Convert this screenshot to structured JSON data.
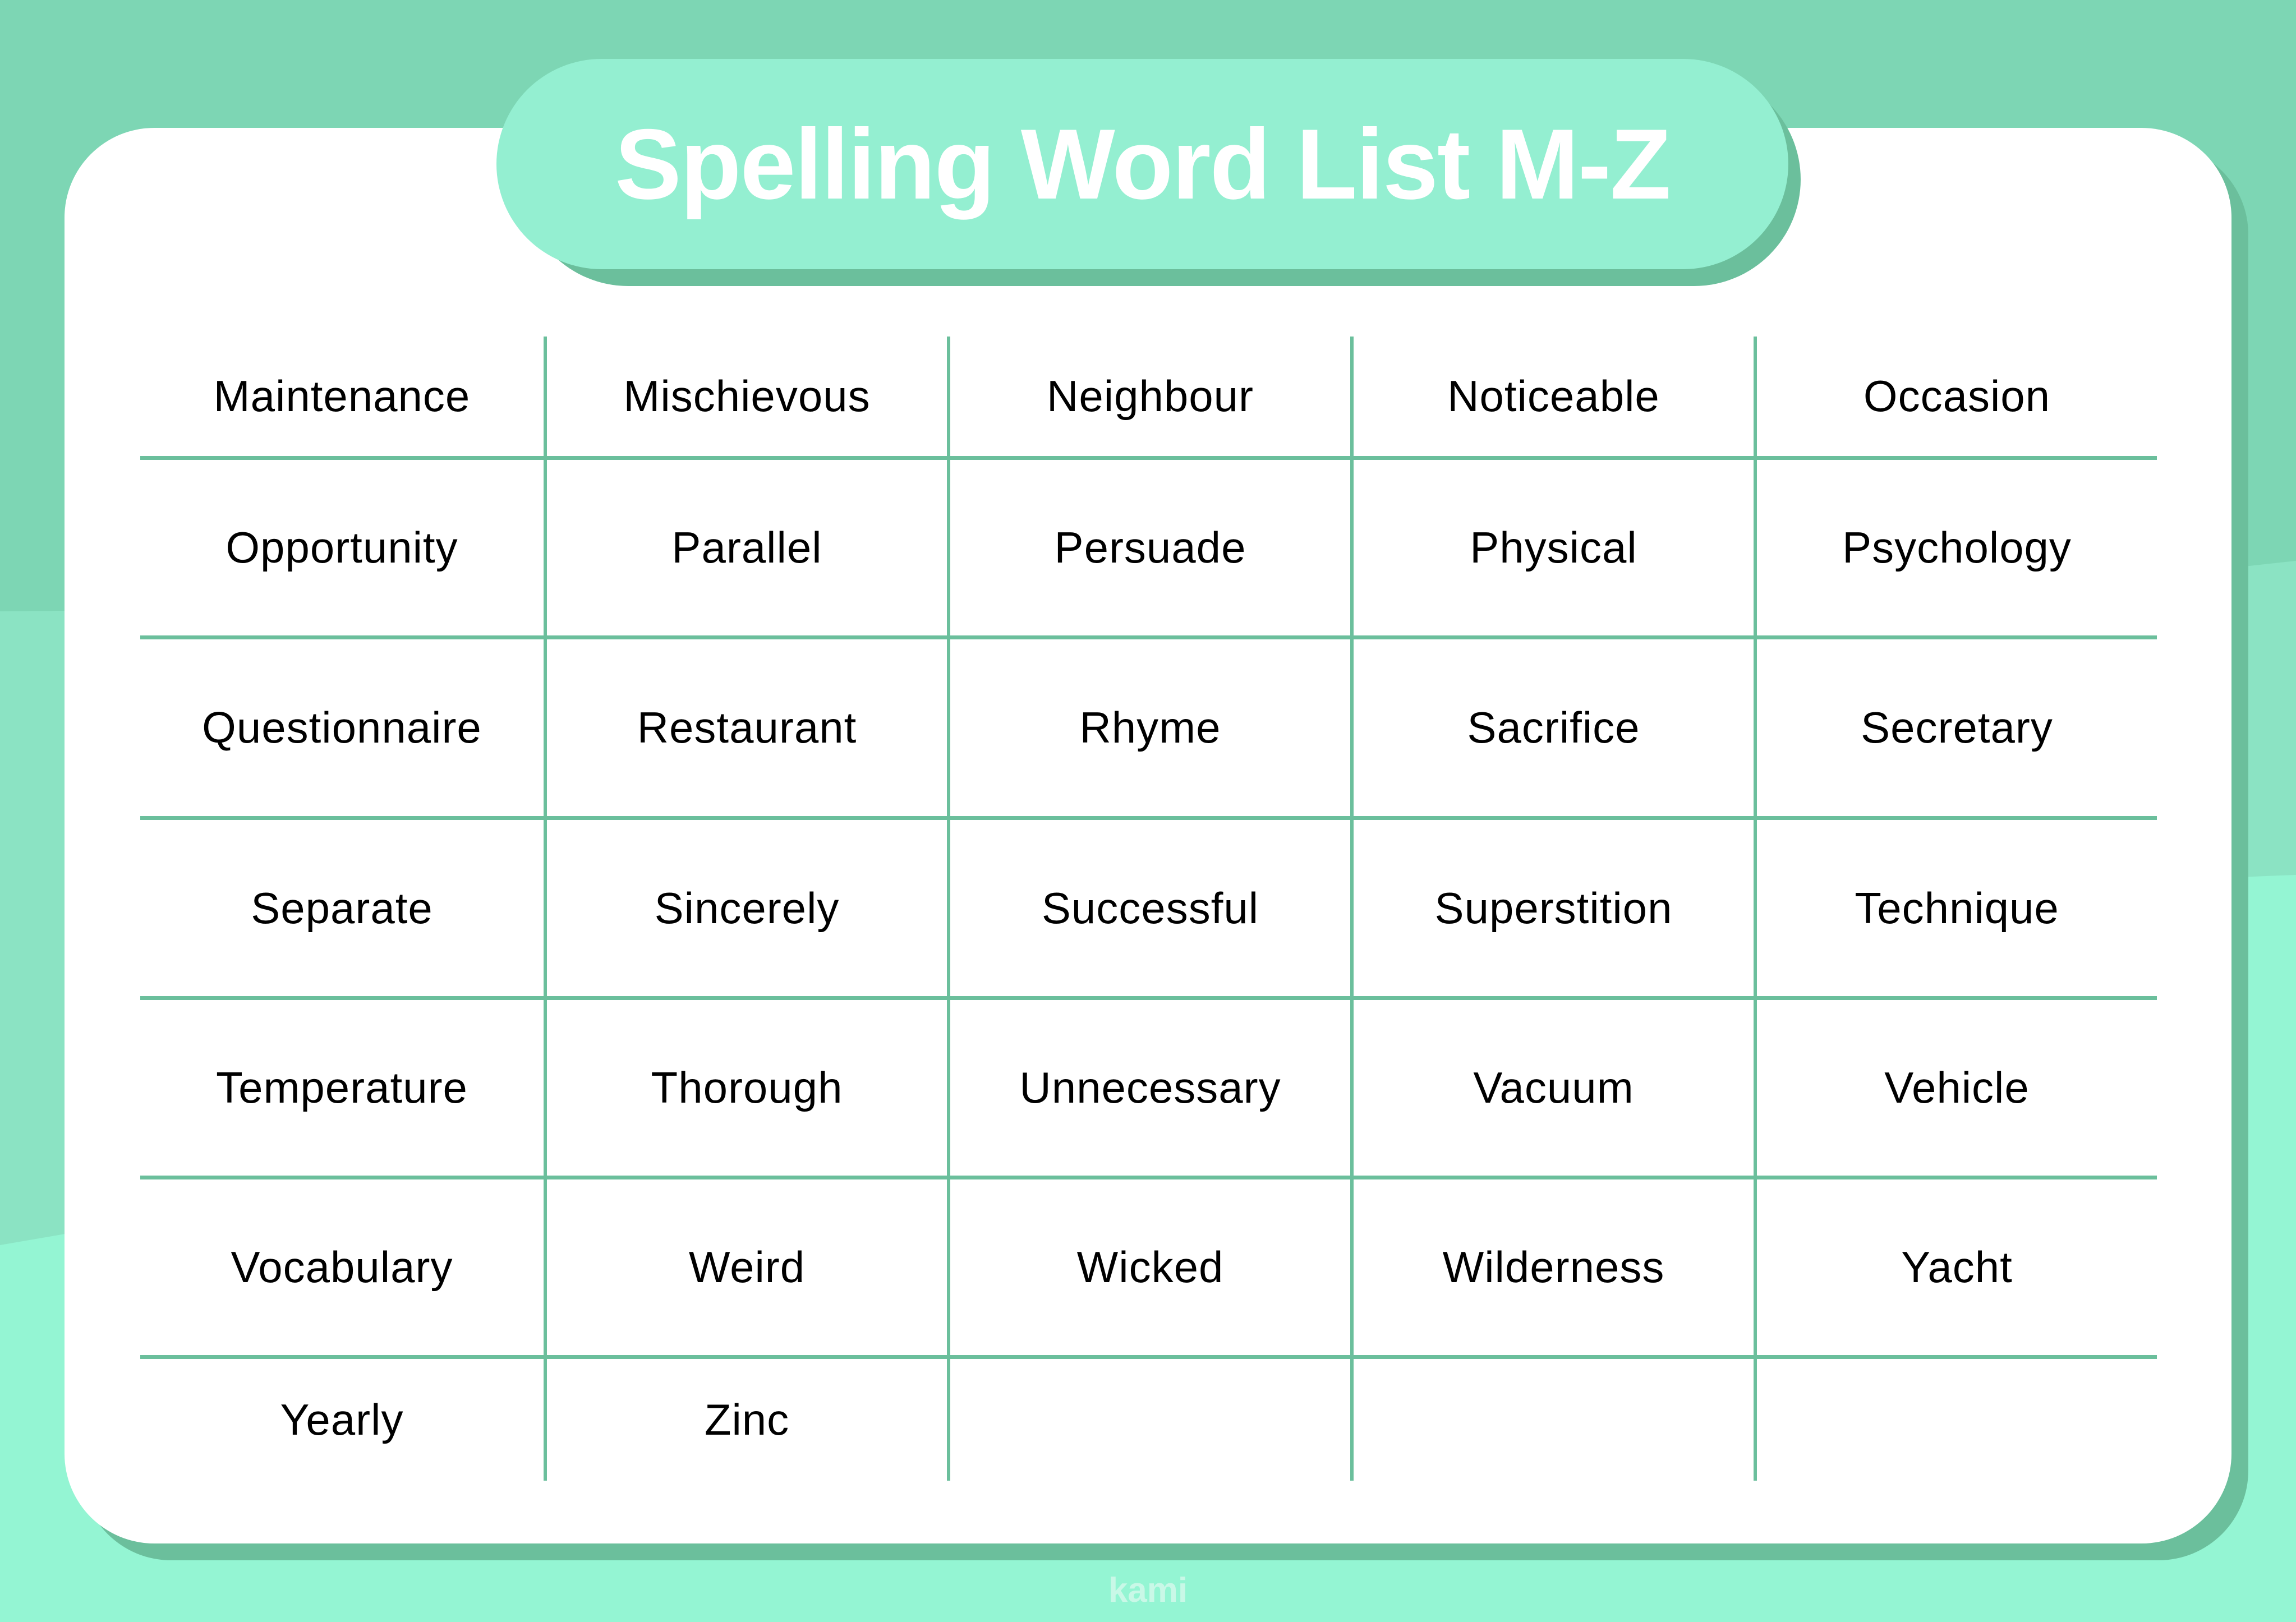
{
  "title": "Spelling Word List M-Z",
  "colors": {
    "background_top": "#7dd6b4",
    "background_middle": "#8be3c3",
    "background_bottom": "#94f5d3",
    "card": "#ffffff",
    "shadow": "#6bbf9c",
    "title_pill": "#94efd1",
    "grid_line": "#6bbf9c",
    "text": "#000000"
  },
  "words": [
    [
      "Maintenance",
      "Mischievous",
      "Neighbour",
      "Noticeable",
      "Occasion"
    ],
    [
      "Opportunity",
      "Parallel",
      "Persuade",
      "Physical",
      "Psychology"
    ],
    [
      "Questionnaire",
      "Restaurant",
      "Rhyme",
      "Sacrifice",
      "Secretary"
    ],
    [
      "Separate",
      "Sincerely",
      "Successful",
      "Superstition",
      "Technique"
    ],
    [
      "Temperature",
      "Thorough",
      "Unnecessary",
      "Vacuum",
      "Vehicle"
    ],
    [
      "Vocabulary",
      "Weird",
      "Wicked",
      "Wilderness",
      "Yacht"
    ],
    [
      "Yearly",
      "Zinc",
      "",
      "",
      ""
    ]
  ],
  "footer": {
    "logo_text": "kami"
  }
}
